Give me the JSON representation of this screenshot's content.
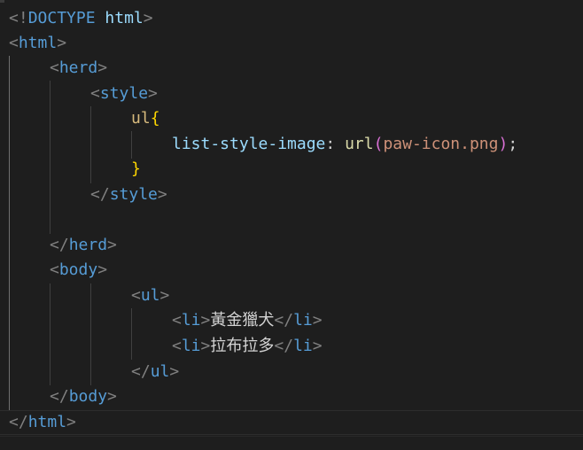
{
  "editor": {
    "language": "html",
    "lines": {
      "doctype": {
        "open": "<!",
        "keyword": "DOCTYPE",
        "space": " ",
        "name": "html",
        "close": ">"
      },
      "html_open": {
        "open": "<",
        "tag": "html",
        "close": ">"
      },
      "herd_open": {
        "open": "<",
        "tag": "herd",
        "close": ">"
      },
      "style_open": {
        "open": "<",
        "tag": "style",
        "close": ">"
      },
      "css_selector": {
        "selector": "ul",
        "brace": "{"
      },
      "css_declaration": {
        "property": "list-style-image",
        "colon": ": ",
        "function": "url",
        "paren_open": "(",
        "value": "paw-icon.png",
        "paren_close": ")",
        "semicolon": ";"
      },
      "css_close": {
        "brace": "}"
      },
      "style_close": {
        "open": "</",
        "tag": "style",
        "close": ">"
      },
      "herd_close": {
        "open": "</",
        "tag": "herd",
        "close": ">"
      },
      "body_open": {
        "open": "<",
        "tag": "body",
        "close": ">"
      },
      "ul_open": {
        "open": "<",
        "tag": "ul",
        "close": ">"
      },
      "li_1": {
        "open": "<",
        "tag": "li",
        "close": ">",
        "text": "黃金獵犬",
        "end_open": "</",
        "end_tag": "li",
        "end_close": ">"
      },
      "li_2": {
        "open": "<",
        "tag": "li",
        "close": ">",
        "text": "拉布拉多",
        "end_open": "</",
        "end_tag": "li",
        "end_close": ">"
      },
      "ul_close": {
        "open": "</",
        "tag": "ul",
        "close": ">"
      },
      "body_close": {
        "open": "</",
        "tag": "body",
        "close": ">"
      },
      "html_close": {
        "open": "</",
        "tag": "html",
        "close": ">"
      }
    }
  },
  "colors": {
    "background": "#1e1e1e",
    "punctuation": "#808080",
    "tag": "#569cd6",
    "selector": "#d7ba7d",
    "brace": "#ffd700",
    "property": "#9cdcfe",
    "function": "#dcdcaa",
    "parenthesis": "#da70d6",
    "string_value": "#ce9178",
    "text": "#d4d4d4"
  }
}
